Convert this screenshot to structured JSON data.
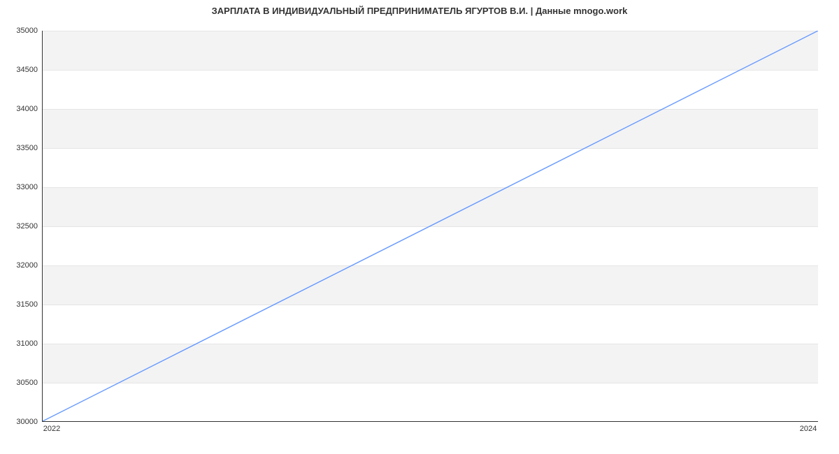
{
  "chart_data": {
    "type": "line",
    "title": "ЗАРПЛАТА В ИНДИВИДУАЛЬНЫЙ ПРЕДПРИНИМАТЕЛЬ ЯГУРТОВ В.И. | Данные mnogo.work",
    "xlabel": "",
    "ylabel": "",
    "x": [
      2022,
      2024
    ],
    "values": [
      30000,
      35000
    ],
    "xlim": [
      2022,
      2024
    ],
    "ylim": [
      30000,
      35000
    ],
    "y_ticks": [
      30000,
      30500,
      31000,
      31500,
      32000,
      32500,
      33000,
      33500,
      34000,
      34500,
      35000
    ],
    "x_ticks": [
      2022,
      2024
    ],
    "line_color": "#6699ff",
    "band_color": "#f3f3f3"
  }
}
